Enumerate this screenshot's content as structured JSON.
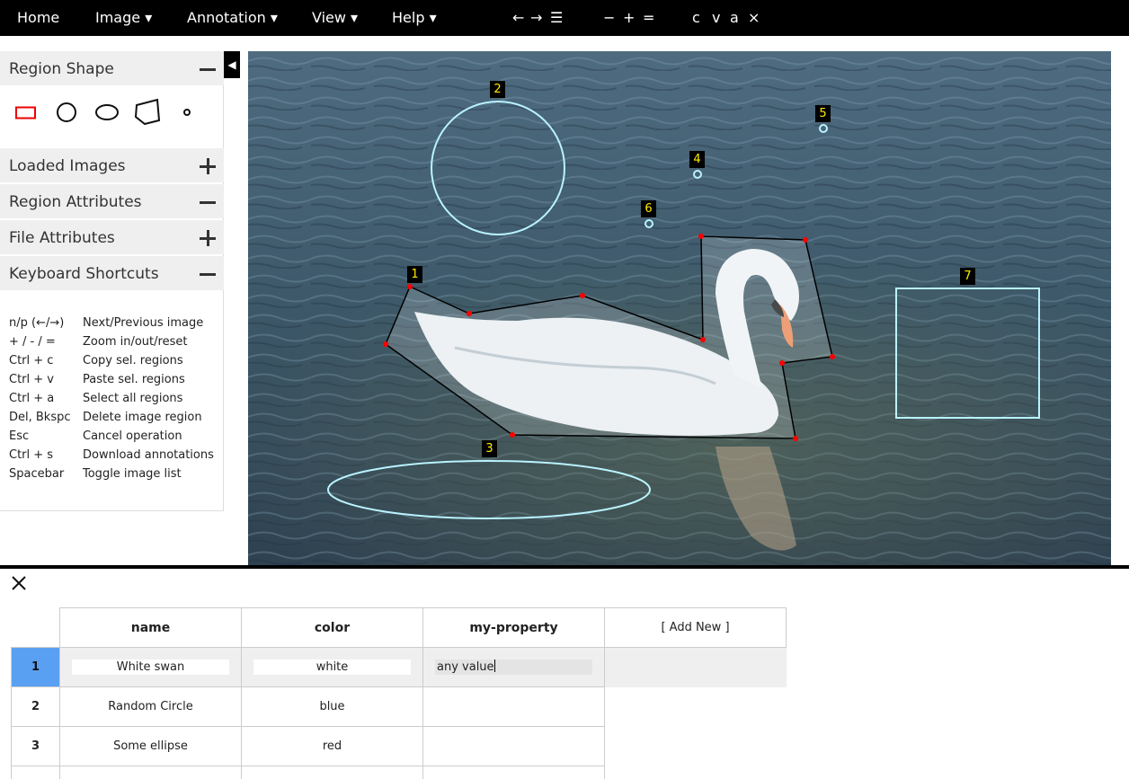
{
  "menu": {
    "items": [
      "Home",
      "Image ▾",
      "Annotation ▾",
      "View ▾",
      "Help ▾"
    ],
    "nav_tools": [
      "←",
      "→",
      "☰"
    ],
    "zoom_tools": [
      "−",
      "+",
      "="
    ],
    "edit_tools": [
      "c",
      "v",
      "a",
      "×"
    ]
  },
  "left_panel": {
    "sections": {
      "region_shape": "Region Shape",
      "loaded_images": "Loaded Images",
      "region_attributes": "Region Attributes",
      "file_attributes": "File Attributes",
      "keyboard_shortcuts": "Keyboard Shortcuts"
    },
    "shape_tools": [
      "rectangle-icon",
      "circle-icon",
      "ellipse-icon",
      "polygon-icon",
      "point-icon"
    ],
    "shortcuts": [
      {
        "key": "n/p (←/→)",
        "desc": "Next/Previous image"
      },
      {
        "key": "+ / - / =",
        "desc": "Zoom in/out/reset"
      },
      {
        "key": "Ctrl + c",
        "desc": "Copy sel. regions"
      },
      {
        "key": "Ctrl + v",
        "desc": "Paste sel. regions"
      },
      {
        "key": "Ctrl + a",
        "desc": "Select all regions"
      },
      {
        "key": "Del, Bkspc",
        "desc": "Delete image region"
      },
      {
        "key": "Esc",
        "desc": "Cancel operation"
      },
      {
        "key": "Ctrl + s",
        "desc": "Download annotations"
      },
      {
        "key": "Spacebar",
        "desc": "Toggle image list"
      }
    ],
    "collapse_icon": "◀"
  },
  "regions": {
    "labels": [
      "1",
      "2",
      "3",
      "4",
      "5",
      "6",
      "7"
    ]
  },
  "attribute_editor": {
    "close_icon": "close-icon",
    "headers": [
      "name",
      "color",
      "my-property"
    ],
    "add_new": "[ Add New ]",
    "rows": [
      {
        "id": "1",
        "name": "White swan",
        "color": "white",
        "my_property": "any value"
      },
      {
        "id": "2",
        "name": "Random Circle",
        "color": "blue",
        "my_property": ""
      },
      {
        "id": "3",
        "name": "Some ellipse",
        "color": "red",
        "my_property": ""
      }
    ]
  },
  "colors": {
    "menu_bg": "#000000",
    "region_outline": "#b9f3ff",
    "label_text": "#ffea00",
    "selected_row_head": "#5aa0f2",
    "vertex": "#ff0000"
  }
}
